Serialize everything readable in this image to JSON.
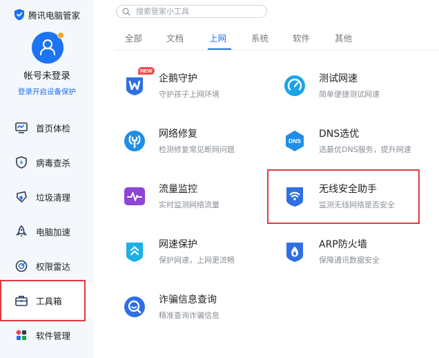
{
  "app": {
    "title": "腾讯电脑管家"
  },
  "account": {
    "name": "帐号未登录",
    "login_link": "登录开启设备保护"
  },
  "sidebar": {
    "items": [
      {
        "label": "首页体检",
        "icon": "monitor-icon"
      },
      {
        "label": "病毒查杀",
        "icon": "shield-bolt-icon"
      },
      {
        "label": "垃圾清理",
        "icon": "broom-icon"
      },
      {
        "label": "电脑加速",
        "icon": "rocket-icon"
      },
      {
        "label": "权限雷达",
        "icon": "radar-icon"
      },
      {
        "label": "工具箱",
        "icon": "toolbox-icon",
        "active": true
      },
      {
        "label": "软件管理",
        "icon": "apps-icon"
      }
    ]
  },
  "search": {
    "placeholder": "搜索管家小工具"
  },
  "tabs": [
    {
      "label": "全部"
    },
    {
      "label": "文档"
    },
    {
      "label": "上网",
      "active": true
    },
    {
      "label": "系统"
    },
    {
      "label": "软件"
    },
    {
      "label": "其他"
    }
  ],
  "tools": [
    {
      "name": "企鹅守护",
      "desc": "守护孩子上网环境",
      "badge": "NEW",
      "icon": "penguin-guard-icon",
      "color": "#2f6fe4"
    },
    {
      "name": "测试网速",
      "desc": "简单便捷测试网速",
      "icon": "speedometer-icon",
      "color": "#1aa3e8"
    },
    {
      "name": "网络修复",
      "desc": "检测修复常见断网问题",
      "icon": "network-repair-icon",
      "color": "#1f8ee8"
    },
    {
      "name": "DNS选优",
      "desc": "选最优DNS服务，提升网速",
      "icon": "dns-icon",
      "icon_text": "DNS",
      "color": "#1f8ee8"
    },
    {
      "name": "流量监控",
      "desc": "实时监测网络流量",
      "icon": "traffic-monitor-icon",
      "color": "#8e44d6"
    },
    {
      "name": "无线安全助手",
      "desc": "监测无线网络是否安全",
      "icon": "wifi-shield-icon",
      "color": "#2f6fe4"
    },
    {
      "name": "网速保护",
      "desc": "保护网速，上网更流畅",
      "icon": "speed-protect-icon",
      "color": "#1ab0e8"
    },
    {
      "name": "ARP防火墙",
      "desc": "保障通讯数据安全",
      "icon": "firewall-icon",
      "color": "#2f6fe4"
    },
    {
      "name": "诈骗信息查询",
      "desc": "精准查询诈骗信息",
      "icon": "fraud-query-icon",
      "color": "#2f6fe4"
    }
  ],
  "colors": {
    "accent": "#1c6ff0",
    "highlight_border": "#e0383e",
    "sidebar_bg": "#f4f7fb"
  }
}
